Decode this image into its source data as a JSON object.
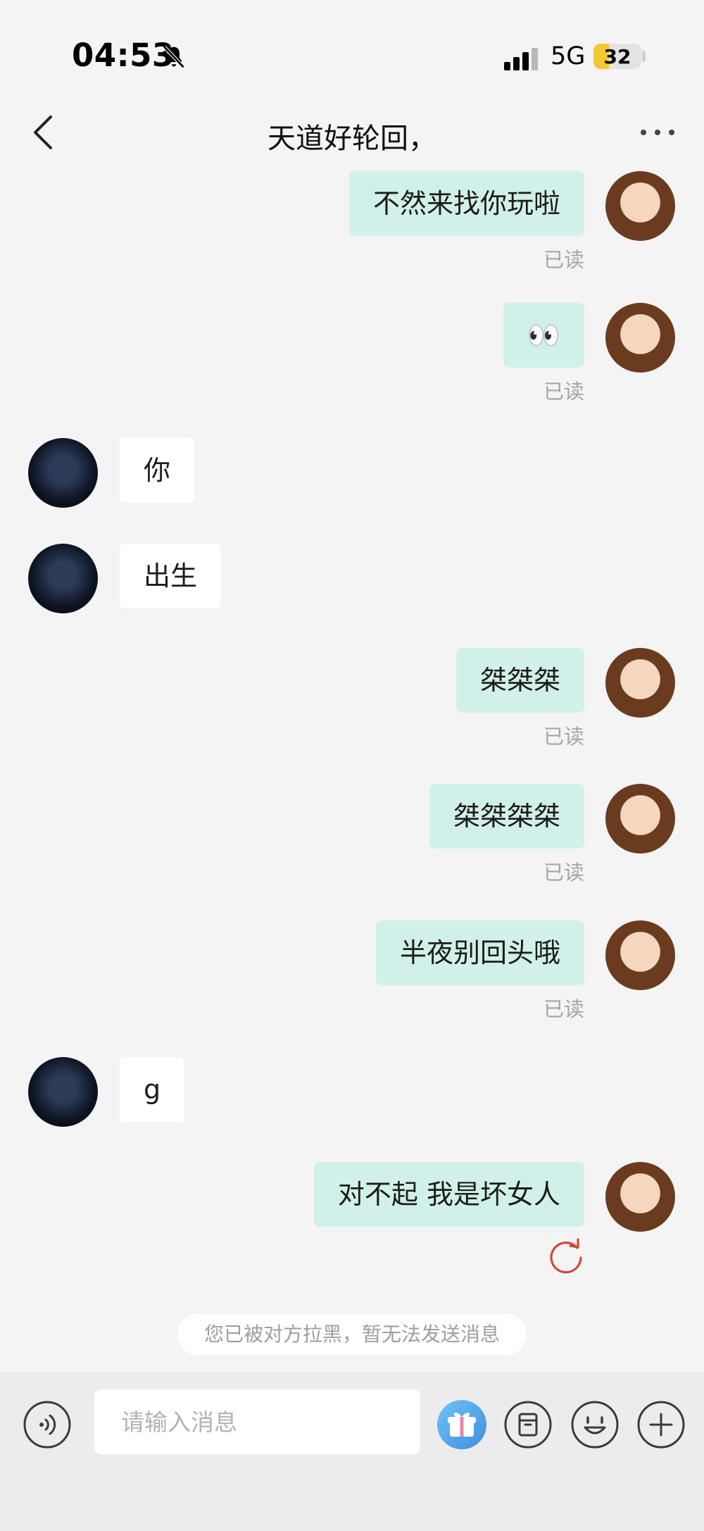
{
  "status_bar": {
    "time": "04:53",
    "network": "5G",
    "battery": "32",
    "battery_level": 0.32
  },
  "nav": {
    "title": "天道好轮回，"
  },
  "messages": [
    {
      "direction": "out",
      "text": "不然来找你玩啦",
      "read": "已读"
    },
    {
      "direction": "out",
      "text": "👀",
      "read": "已读"
    },
    {
      "direction": "in",
      "text": "你"
    },
    {
      "direction": "in",
      "text": "出生"
    },
    {
      "direction": "out",
      "text": "桀桀桀",
      "read": "已读"
    },
    {
      "direction": "out",
      "text": "桀桀桀桀",
      "read": "已读"
    },
    {
      "direction": "out",
      "text": "半夜别回头哦",
      "read": "已读"
    },
    {
      "direction": "in",
      "text": "g"
    },
    {
      "direction": "out",
      "text": "对不起 我是坏女人",
      "status": "failed"
    }
  ],
  "notice": "您已被对方拉黑，暂无法发送消息",
  "input": {
    "placeholder": "请输入消息",
    "value": ""
  },
  "colors": {
    "outgoing_bubble": "#d2f0ea",
    "incoming_bubble": "#ffffff",
    "gift_button": "#58a8e8",
    "resend": "#d6463c"
  },
  "icons": [
    "back-arrow-icon",
    "more-icon",
    "voice-icon",
    "gift-icon",
    "sticker-box-icon",
    "emoji-icon",
    "plus-icon",
    "resend-icon"
  ]
}
